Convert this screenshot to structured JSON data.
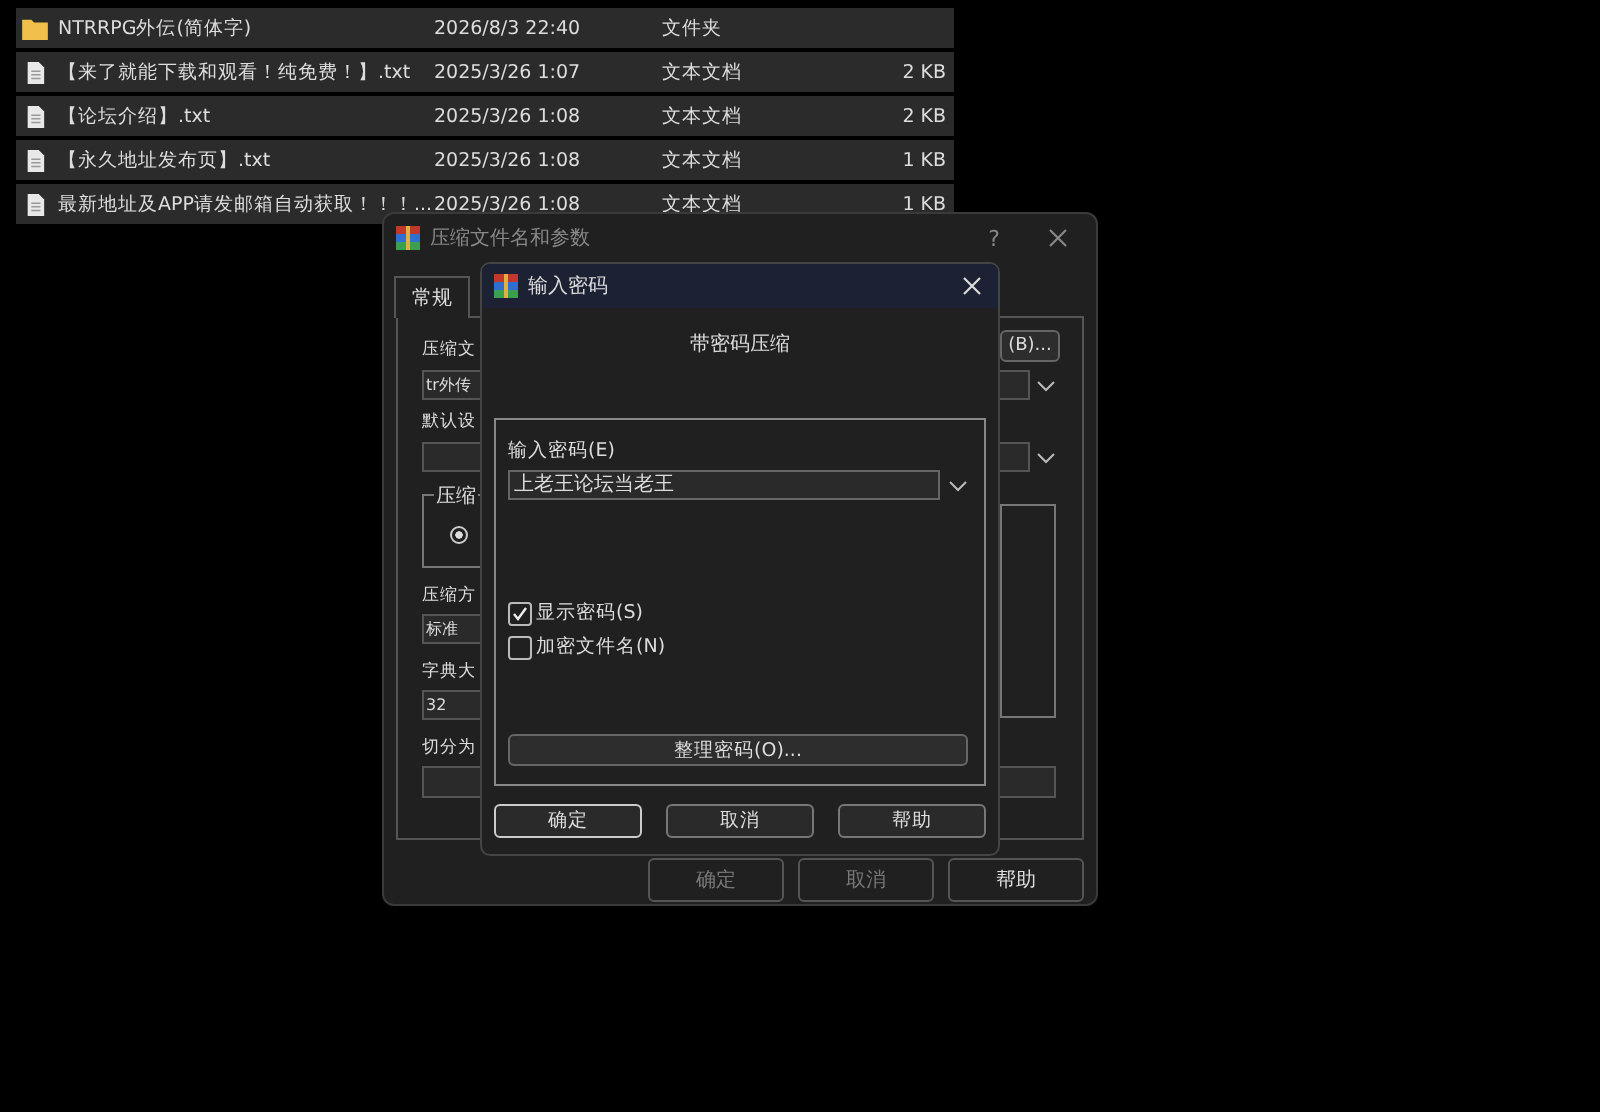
{
  "file_list": {
    "rows": [
      {
        "kind": "folder",
        "name": "NTRRPG外伝(简体字)",
        "date": "2026/8/3 22:40",
        "type": "文件夹"
      },
      {
        "kind": "file",
        "name": "【来了就能下载和观看！纯免费！】.txt",
        "date": "2025/3/26 1:07",
        "type": "文本文档",
        "size": "2 KB"
      },
      {
        "kind": "file",
        "name": "【论坛介绍】.txt",
        "date": "2025/3/26 1:08",
        "type": "文本文档",
        "size": "2 KB"
      },
      {
        "kind": "file",
        "name": "【永久地址发布页】.txt",
        "date": "2025/3/26 1:08",
        "type": "文本文档",
        "size": "1 KB"
      },
      {
        "kind": "file",
        "name": "最新地址及APP请发邮箱自动获取！！！....",
        "date": "2025/3/26 1:08",
        "type": "文本文档",
        "size": "1 KB"
      }
    ]
  },
  "archive_dialog": {
    "title": "压缩文件名和参数",
    "help": "?",
    "tabs": [
      {
        "label": "常规",
        "selected": true
      }
    ],
    "archive_name_label": "压缩文",
    "browse_button": "(B)...",
    "archive_name": "tr外传",
    "profile_label": "默认设",
    "group_label": "压缩",
    "group_radio": {
      "selected": true
    },
    "method_label": "压缩方",
    "method": "标准",
    "dictionary_label": "字典大",
    "dictionary": "32",
    "split_label": "切分为",
    "buttons": [
      {
        "label": "确定",
        "disabled": true
      },
      {
        "label": "取消",
        "disabled": true
      },
      {
        "label": "帮助",
        "disabled": false
      }
    ]
  },
  "password_dialog": {
    "title": "输入密码",
    "heading": "带密码压缩",
    "password_label": "输入密码(E)",
    "password": "上老王论坛当老王",
    "checkboxes": [
      {
        "label": "显示密码(S)",
        "checked": true
      },
      {
        "label": "加密文件名(N)",
        "checked": false
      }
    ],
    "organize_button": "整理密码(O)...",
    "buttons": [
      {
        "label": "确定",
        "selected": true
      },
      {
        "label": "取消",
        "selected": false
      },
      {
        "label": "帮助",
        "selected": false
      }
    ]
  }
}
